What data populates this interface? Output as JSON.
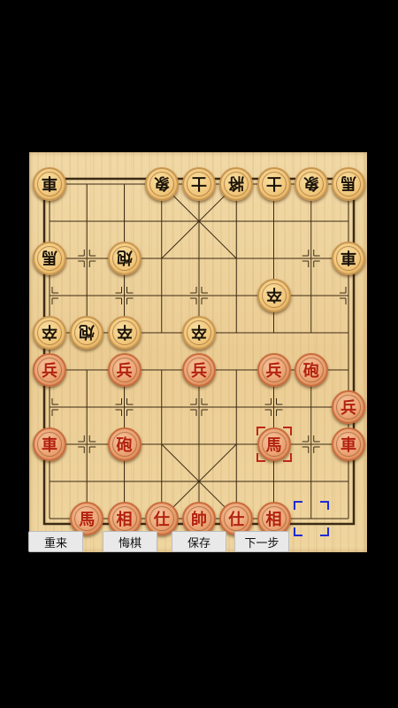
{
  "board": {
    "rows": [
      [
        "車",
        "",
        "",
        "象",
        "士",
        "將",
        "士",
        "象",
        "馬"
      ],
      [
        "",
        "",
        "",
        "",
        "",
        "",
        "",
        "",
        ""
      ],
      [
        "馬",
        "",
        "炮",
        "",
        "",
        "",
        "",
        "",
        "車"
      ],
      [
        "",
        "",
        "",
        "",
        "",
        "",
        "卒",
        "",
        ""
      ],
      [
        "卒",
        "炮",
        "卒",
        "",
        "卒",
        "",
        "",
        "",
        ""
      ],
      [
        "兵",
        "",
        "兵",
        "",
        "兵",
        "",
        "兵",
        "砲",
        ""
      ],
      [
        "",
        "",
        "",
        "",
        "",
        "",
        "",
        "",
        "兵"
      ],
      [
        "車",
        "",
        "砲",
        "",
        "",
        "",
        "馬",
        "",
        "車"
      ],
      [
        "",
        "",
        "",
        "",
        "",
        "",
        "",
        "",
        ""
      ],
      [
        "",
        "馬",
        "相",
        "仕",
        "帥",
        "仕",
        "相",
        "",
        ""
      ]
    ],
    "sides": [
      [
        "black",
        "",
        "",
        "black",
        "black",
        "black",
        "black",
        "black",
        "black"
      ],
      [
        "",
        "",
        "",
        "",
        "",
        "",
        "",
        "",
        ""
      ],
      [
        "black",
        "",
        "black",
        "",
        "",
        "",
        "",
        "",
        "black"
      ],
      [
        "",
        "",
        "",
        "",
        "",
        "",
        "black",
        "",
        ""
      ],
      [
        "black",
        "black",
        "black",
        "",
        "black",
        "",
        "",
        "",
        ""
      ],
      [
        "red",
        "",
        "red",
        "",
        "red",
        "",
        "red",
        "red",
        ""
      ],
      [
        "",
        "",
        "",
        "",
        "",
        "",
        "",
        "",
        "red"
      ],
      [
        "red",
        "",
        "red",
        "",
        "",
        "",
        "red",
        "",
        "red"
      ],
      [
        "",
        "",
        "",
        "",
        "",
        "",
        "",
        "",
        ""
      ],
      [
        "",
        "red",
        "red",
        "red",
        "red",
        "red",
        "red",
        "",
        ""
      ]
    ],
    "selected_piece": {
      "col": 6,
      "row": 7
    },
    "move_target": {
      "col": 7,
      "row": 9
    }
  },
  "buttons": {
    "restart": "重来",
    "undo": "悔棋",
    "save": "保存",
    "next": "下一步"
  },
  "colors": {
    "board": "#efd59f",
    "lines": "#3b2a14",
    "red_text": "#b3210f",
    "black_text": "#1a1208",
    "selection_red": "#c0261a",
    "selection_blue": "#1d2bd6"
  }
}
